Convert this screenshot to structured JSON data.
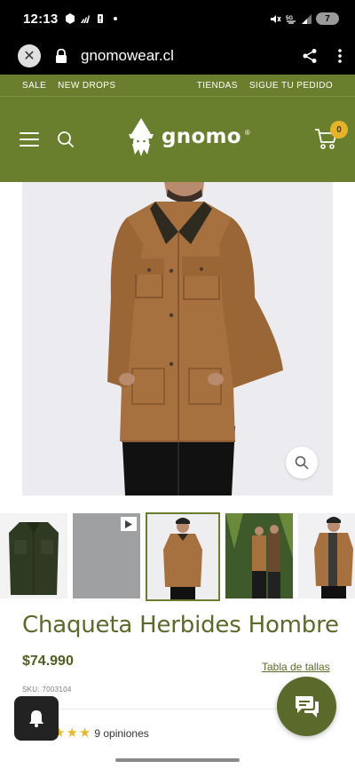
{
  "status_bar": {
    "time": "12:13",
    "battery": "7",
    "icons": [
      "gallery-icon",
      "adidas-icon",
      "alert-icon",
      "dot-icon",
      "mute-icon",
      "5g-icon",
      "signal-icon",
      "battery-icon"
    ]
  },
  "browser": {
    "url": "gnomowear.cl",
    "icons": [
      "close-icon",
      "lock-icon",
      "share-icon",
      "kebab-menu-icon"
    ]
  },
  "top_strip": {
    "left_links": [
      "SALE",
      "NEW DROPS"
    ],
    "right_links": [
      "TIENDAS",
      "SIGUE TU PEDIDO"
    ]
  },
  "header": {
    "logo_text": "gnomo",
    "cart_count": "0"
  },
  "product": {
    "title": "Chaqueta Herbides Hombre",
    "price": "$74.990",
    "size_guide_label": "Tabla de tallas",
    "sku": "SKU: 7003104",
    "rating_count_label": "9 opiniones",
    "rating_stars": 5
  },
  "thumbnails": [
    {
      "name": "thumb-green-jacket",
      "active": false
    },
    {
      "name": "thumb-video",
      "active": false
    },
    {
      "name": "thumb-brown-jacket-front",
      "active": true
    },
    {
      "name": "thumb-forest",
      "active": false
    },
    {
      "name": "thumb-model-side",
      "active": false
    }
  ],
  "colors": {
    "brand_green": "#6a7f2e",
    "title_green": "#5a6a2a",
    "badge_yellow": "#e6b22a",
    "star_yellow": "#e9b829"
  }
}
